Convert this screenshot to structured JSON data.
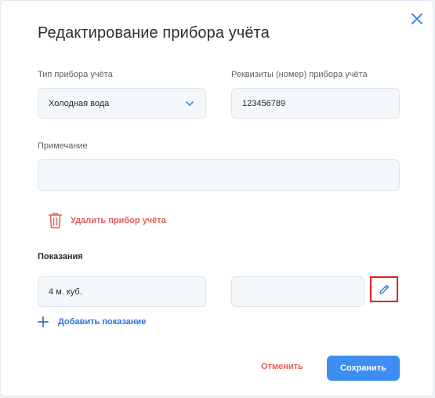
{
  "modal": {
    "title": "Редактирование прибора учёта"
  },
  "form": {
    "meter_type": {
      "label": "Тип прибора учёта",
      "value": "Холодная вода"
    },
    "meter_details": {
      "label": "Реквизиты (номер) прибора учёта",
      "value": "123456789"
    },
    "note": {
      "label": "Примечание",
      "value": ""
    }
  },
  "delete_action": {
    "label": "Удалить прибор учёта"
  },
  "readings": {
    "heading": "Показания",
    "items": [
      {
        "value": "4 м. куб.",
        "second_value": ""
      }
    ],
    "add_label": "Добавить показание"
  },
  "footer": {
    "cancel_label": "Отменить",
    "save_label": "Сохранить"
  },
  "icons": {
    "close": "close-icon",
    "dropdown": "chevron-down-icon",
    "delete": "trash-icon",
    "edit": "pencil-icon",
    "add": "plus-icon"
  },
  "colors": {
    "accent": "#3d8ef0",
    "link": "#2b73d6",
    "danger": "#e85a5a",
    "highlight_border": "#e01f1f"
  }
}
